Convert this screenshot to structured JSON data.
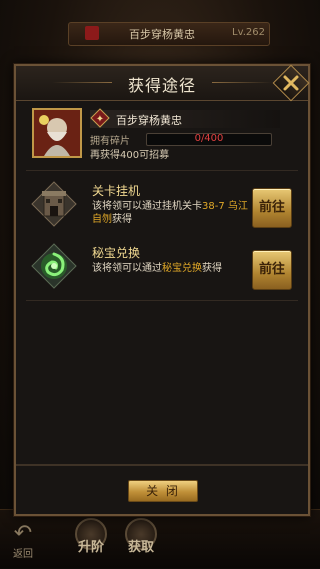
{
  "background": {
    "hero_name": "百步穿杨黄忠",
    "hero_level": "Lv.262",
    "back_label": "返回",
    "upgrade_label": "升阶",
    "obtain_label": "获取"
  },
  "dialog": {
    "title": "获得途径",
    "close_x_icon": "close-x-icon"
  },
  "hero": {
    "faction_icon": "faction-badge-icon",
    "name": "百步穿杨黄忠",
    "fragments_label": "拥有碎片",
    "fragments_text": "0/400",
    "fragments_current": 0,
    "fragments_total": 400,
    "recruit_hint": "再获得400可招募"
  },
  "sources": [
    {
      "name": "关卡挂机",
      "icon": "stage-tower-icon",
      "desc_prefix": "该将领可以通过挂机关卡",
      "desc_highlight": "38-7 乌江自刎",
      "desc_suffix": "获得",
      "button": "前往"
    },
    {
      "name": "秘宝兑换",
      "icon": "green-swirl-treasure-icon",
      "desc_prefix": "该将领可以通过",
      "desc_highlight": "秘宝兑换",
      "desc_suffix": "获得",
      "button": "前往"
    }
  ],
  "footer": {
    "close_button": "关 闭"
  },
  "colors": {
    "accent_gold": "#c09038",
    "highlight": "#e0a828",
    "progress_red": "#c83a2a"
  }
}
